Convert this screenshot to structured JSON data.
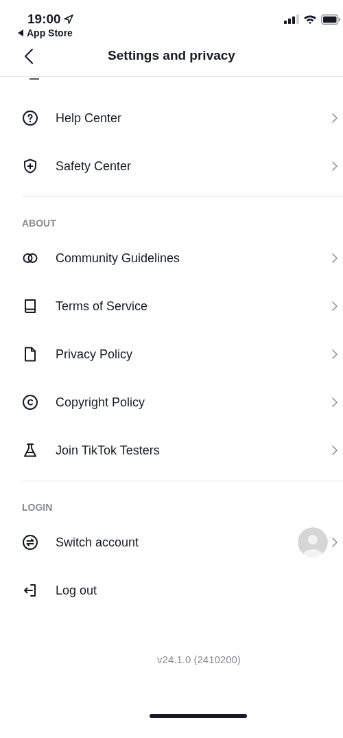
{
  "status_bar": {
    "time": "19:00",
    "back_app": "App Store"
  },
  "header": {
    "title": "Settings and privacy"
  },
  "sections": [
    {
      "items": [
        {
          "label": "Help Center",
          "chevron": true
        },
        {
          "label": "Safety Center",
          "chevron": true
        }
      ]
    },
    {
      "heading": "ABOUT",
      "items": [
        {
          "label": "Community Guidelines",
          "chevron": true
        },
        {
          "label": "Terms of Service",
          "chevron": true
        },
        {
          "label": "Privacy Policy",
          "chevron": true
        },
        {
          "label": "Copyright Policy",
          "chevron": true
        },
        {
          "label": "Join TikTok Testers",
          "chevron": true
        }
      ]
    },
    {
      "heading": "LOGIN",
      "items": [
        {
          "label": "Switch account",
          "chevron": true,
          "avatar": true
        },
        {
          "label": "Log out",
          "chevron": false
        }
      ]
    }
  ],
  "version": "v24.1.0 (2410200)"
}
